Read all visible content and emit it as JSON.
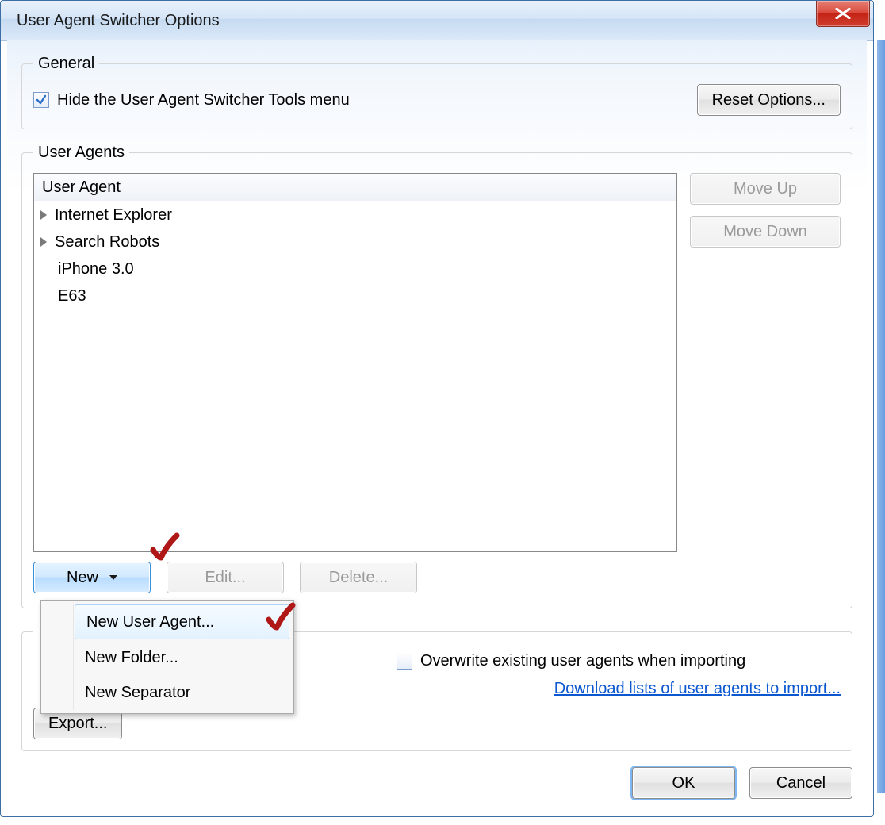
{
  "window": {
    "title": "User Agent Switcher Options"
  },
  "groups": {
    "general": {
      "legend": "General",
      "hide_menu_label": "Hide the User Agent Switcher Tools menu",
      "hide_menu_checked": true,
      "reset_label": "Reset Options..."
    },
    "user_agents": {
      "legend": "User Agents",
      "column_header": "User Agent",
      "items": [
        {
          "label": "Internet Explorer",
          "expandable": true
        },
        {
          "label": "Search Robots",
          "expandable": true
        },
        {
          "label": "iPhone 3.0",
          "expandable": false
        },
        {
          "label": "E63",
          "expandable": false
        }
      ],
      "buttons": {
        "move_up": "Move Up",
        "move_down": "Move Down",
        "new": "New",
        "edit": "Edit...",
        "delete": "Delete..."
      },
      "new_menu": {
        "new_user_agent": "New User Agent...",
        "new_folder": "New Folder...",
        "new_separator": "New Separator"
      }
    },
    "import": {
      "export_label": "Export...",
      "overwrite_label": "Overwrite existing user agents when importing",
      "overwrite_checked": false,
      "download_link": "Download lists of user agents to import..."
    }
  },
  "footer": {
    "ok": "OK",
    "cancel": "Cancel"
  }
}
